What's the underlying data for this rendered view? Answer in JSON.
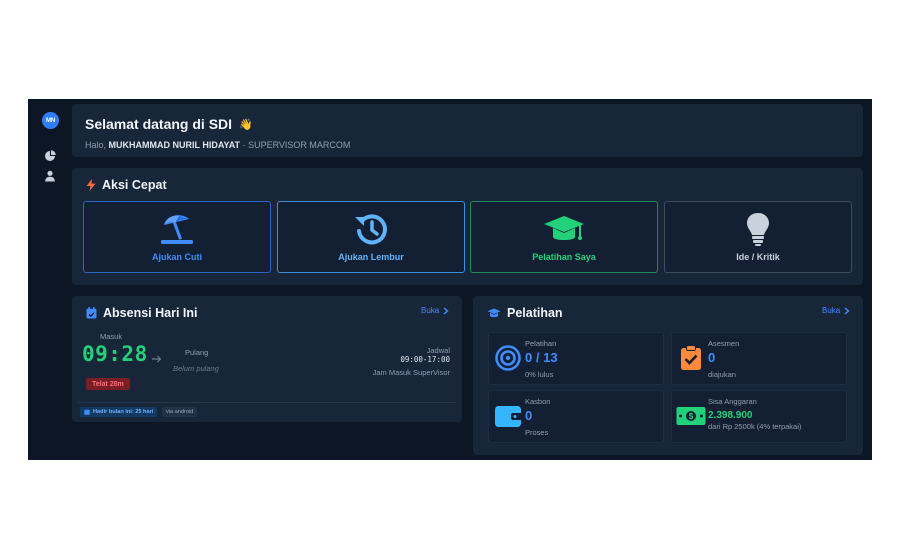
{
  "sidebar": {
    "avatar_initials": "MN",
    "items": [
      {
        "icon": "chart-pie-icon"
      },
      {
        "icon": "user-icon"
      }
    ]
  },
  "welcome": {
    "title": "Selamat datang di SDI",
    "wave_emoji": "👋",
    "greeting": "Halo,",
    "user_name": "MUKHAMMAD NURIL HIDAYAT",
    "separator": "·",
    "role": "SUPERVISOR MARCOM"
  },
  "quick_actions": {
    "title": "Aksi Cepat",
    "items": [
      {
        "label": "Ajukan Cuti",
        "icon": "beach-umbrella-icon",
        "color": "#3f8cff"
      },
      {
        "label": "Ajukan Lembur",
        "icon": "history-clock-icon",
        "color": "#5fb3ff"
      },
      {
        "label": "Pelatihan Saya",
        "icon": "graduation-cap-icon",
        "color": "#23d17a"
      },
      {
        "label": "Ide / Kritik",
        "icon": "lightbulb-icon",
        "color": "#c9d1db"
      }
    ]
  },
  "attendance": {
    "title": "Absensi Hari Ini",
    "open_link": "Buka",
    "check_in_label": "Masuk",
    "check_in_time": "09:28",
    "check_out_label": "Pulang",
    "check_out_status": "Belum pulang",
    "schedule_label": "Jadwal",
    "schedule_time": "09:00-17:00",
    "schedule_note": "Jam Masuk SuperVisor",
    "late_badge": "Telat 28m",
    "present_chip": "Hadir bulan ini: 25 hari",
    "via_chip": "via android"
  },
  "training": {
    "title": "Pelatihan",
    "open_link": "Buka",
    "stats": [
      {
        "label": "Pelatihan",
        "value": "0",
        "value_suffix": "/ 13",
        "note": "0% lulus",
        "icon": "target-icon",
        "color": "#3f8cff"
      },
      {
        "label": "Asesmen",
        "value": "0",
        "note": "diajukan",
        "icon": "clipboard-check-icon",
        "color": "#ff8a3d"
      },
      {
        "label": "Kasbon",
        "value": "0",
        "note": "Proses",
        "icon": "wallet-icon",
        "color": "#36b5ff"
      },
      {
        "label": "Sisa Anggaran",
        "value": "2.398.900",
        "note": "dari Rp 2500k (4% terpakai)",
        "icon": "money-bill-icon",
        "color": "#23d17a"
      }
    ]
  },
  "colors": {
    "background": "#0d1624",
    "card": "#18263a",
    "accent_blue": "#3f8cff",
    "accent_green": "#23d17a",
    "danger": "#ff6b74"
  }
}
